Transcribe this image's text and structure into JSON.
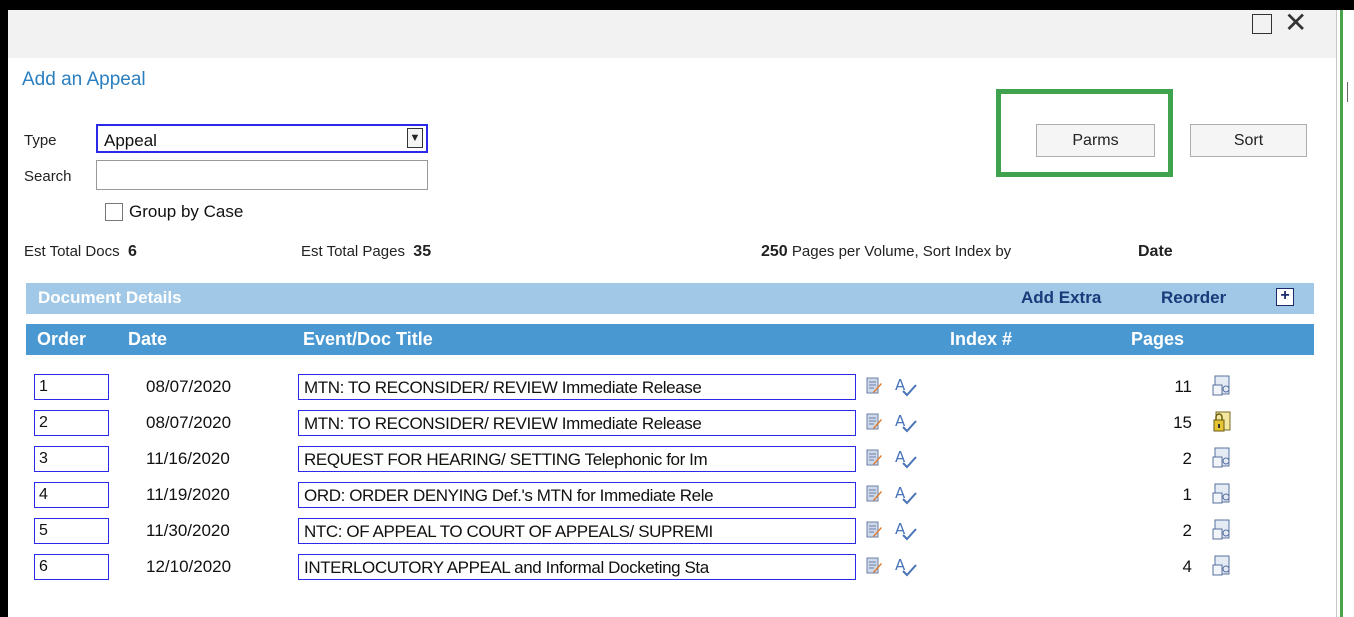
{
  "window": {
    "maximize_icon": "maximize-icon",
    "close_glyph": "✕"
  },
  "app": {
    "title": "Add an Appeal"
  },
  "form": {
    "type_label": "Type",
    "type_value": "Appeal",
    "dropdown_glyph": "▼",
    "search_label": "Search",
    "search_value": "",
    "group_by_case_label": "Group by Case",
    "group_by_case_checked": false
  },
  "buttons": {
    "parms": "Parms",
    "sort": "Sort"
  },
  "stats": {
    "est_total_docs_label": "Est Total Docs",
    "est_total_docs_value": "6",
    "est_total_pages_label": "Est Total Pages",
    "est_total_pages_value": "35",
    "pages_per_volume_value": "250",
    "pages_per_volume_label": "Pages per Volume, Sort Index by",
    "sort_index_by_value": "Date"
  },
  "section": {
    "title": "Document Details",
    "add_extra": "Add Extra",
    "reorder": "Reorder",
    "plus_glyph": "+"
  },
  "table": {
    "headers": {
      "order": "Order",
      "date": "Date",
      "title": "Event/Doc Title",
      "index": "Index #",
      "pages": "Pages"
    },
    "rows": [
      {
        "order": "1",
        "date": "08/07/2020",
        "title": "MTN: TO RECONSIDER/ REVIEW Immediate Release",
        "pages": "11",
        "doc_icon": "document-icon"
      },
      {
        "order": "2",
        "date": "08/07/2020",
        "title": "MTN: TO RECONSIDER/ REVIEW Immediate Release",
        "pages": "15",
        "doc_icon": "locked-document-icon"
      },
      {
        "order": "3",
        "date": "11/16/2020",
        "title": "REQUEST FOR HEARING/ SETTING Telephonic for Im",
        "pages": "2",
        "doc_icon": "document-icon"
      },
      {
        "order": "4",
        "date": "11/19/2020",
        "title": "ORD: ORDER DENYING Def.'s MTN for Immediate Rele",
        "pages": "1",
        "doc_icon": "document-icon"
      },
      {
        "order": "5",
        "date": "11/30/2020",
        "title": "NTC: OF APPEAL TO COURT OF APPEALS/ SUPREMI",
        "pages": "2",
        "doc_icon": "document-icon"
      },
      {
        "order": "6",
        "date": "12/10/2020",
        "title": "INTERLOCUTORY APPEAL and Informal Docketing Sta",
        "pages": "4",
        "doc_icon": "document-icon"
      }
    ]
  },
  "colors": {
    "accent": "#2a7fc1",
    "section_band": "#a1c8e6",
    "header_band": "#4a98d2",
    "highlight": "#3fa34d",
    "field_border": "#2a2ae8"
  }
}
